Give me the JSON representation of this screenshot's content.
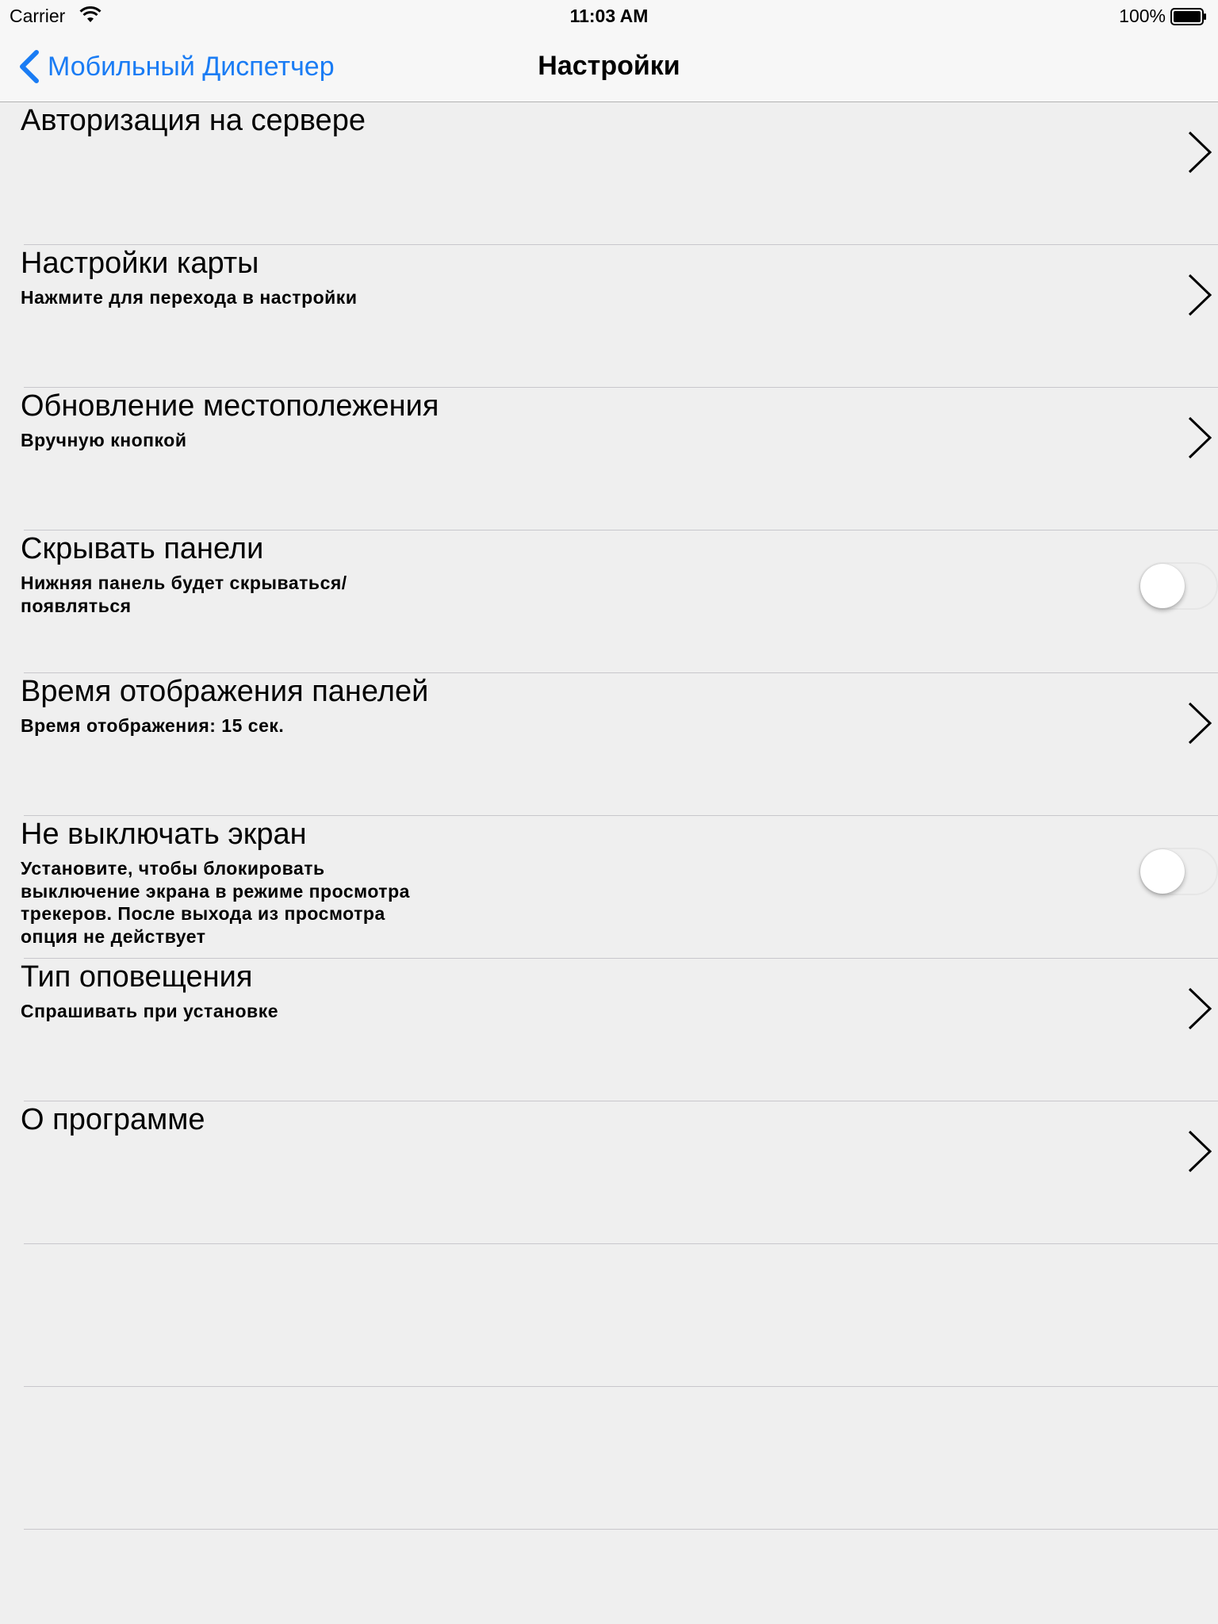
{
  "status_bar": {
    "carrier": "Carrier",
    "time": "11:03 AM",
    "battery": "100%"
  },
  "nav": {
    "back_label": "Мобильный Диспетчер",
    "title": "Настройки",
    "accent_color": "#1a7cf4"
  },
  "settings": [
    {
      "title": "Авторизация на сервере",
      "subtitle": "",
      "control": "chevron"
    },
    {
      "title": "Настройки карты",
      "subtitle": "Нажмите для перехода в настройки",
      "control": "chevron"
    },
    {
      "title": "Обновление местополежения",
      "subtitle": "Вручную кнопкой",
      "control": "chevron"
    },
    {
      "title": "Скрывать панели",
      "subtitle": "Нижняя панель будет скрываться/ появляться",
      "control": "toggle",
      "toggle_on": false
    },
    {
      "title": "Время отображения панелей",
      "subtitle": "Время отображения: 15 сек.",
      "control": "chevron"
    },
    {
      "title": "Не выключать экран",
      "subtitle": "Установите, чтобы блокировать выключение экрана в режиме просмотра трекеров. После выхода из просмотра опция не действует",
      "control": "toggle",
      "toggle_on": false
    },
    {
      "title": "Тип оповещения",
      "subtitle": "Спрашивать при установке",
      "control": "chevron"
    },
    {
      "title": "О программе",
      "subtitle": "",
      "control": "chevron"
    }
  ]
}
